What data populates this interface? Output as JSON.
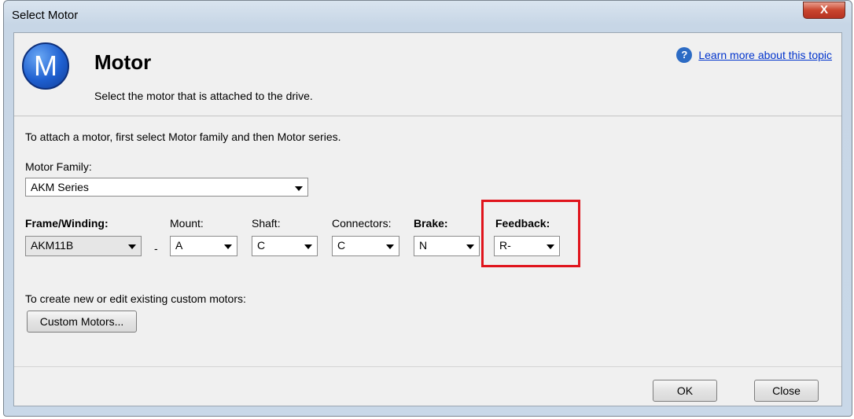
{
  "window": {
    "title": "Select Motor",
    "close_glyph": "X"
  },
  "header": {
    "logo_letter": "M",
    "title": "Motor",
    "subtitle": "Select the motor that is attached to the drive.",
    "help_icon": "question-icon",
    "help_glyph": "?",
    "help_link": "Learn more about this topic"
  },
  "body": {
    "instruction": "To attach a motor, first select Motor family and then Motor series.",
    "motor_family_label": "Motor Family:",
    "motor_family_value": "AKM Series",
    "fields": {
      "frame_winding": {
        "label": "Frame/Winding:",
        "value": "AKM11B"
      },
      "separator": "-",
      "mount": {
        "label": "Mount:",
        "value": "A"
      },
      "shaft": {
        "label": "Shaft:",
        "value": "C"
      },
      "connectors": {
        "label": "Connectors:",
        "value": "C"
      },
      "brake": {
        "label": "Brake:",
        "value": "N"
      },
      "feedback": {
        "label": "Feedback:",
        "value": "R-"
      }
    },
    "custom_label": "To create new or edit existing custom motors:",
    "custom_button": "Custom Motors..."
  },
  "footer": {
    "ok_label": "OK",
    "close_label": "Close"
  },
  "colors": {
    "highlight": "#e0141c",
    "link": "#0033cc"
  }
}
